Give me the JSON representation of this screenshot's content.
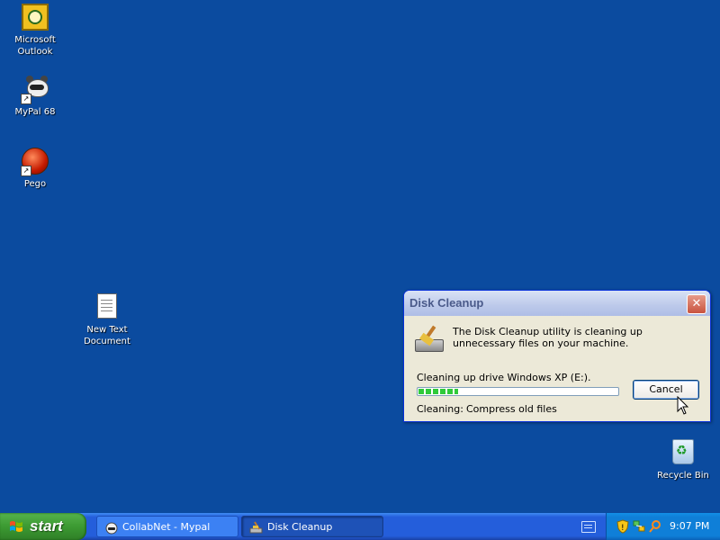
{
  "desktop": {
    "icons": [
      {
        "label_line1": "Microsoft",
        "label_line2": "Outlook",
        "icon": "outlook-icon"
      },
      {
        "label_line1": "MyPal 68",
        "label_line2": "",
        "icon": "mypal-icon"
      },
      {
        "label_line1": "Pego",
        "label_line2": "",
        "icon": "pego-icon"
      },
      {
        "label_line1": "New Text",
        "label_line2": "Document",
        "icon": "text-document-icon"
      },
      {
        "label_line1": "Recycle Bin",
        "label_line2": "",
        "icon": "recycle-bin-icon"
      }
    ]
  },
  "dialog": {
    "title": "Disk Cleanup",
    "description": "The Disk Cleanup utility is cleaning up unnecessary files on your machine.",
    "progress_label": "Cleaning up drive Windows XP (E:).",
    "progress_fraction": 0.2,
    "cancel_label": "Cancel",
    "cleaning_label": "Cleaning:",
    "cleaning_value": "Compress old files",
    "close_glyph": "✕"
  },
  "taskbar": {
    "start_label": "start",
    "tasks": [
      {
        "label": "CollabNet - Mypal",
        "icon": "mypal-icon",
        "active": false
      },
      {
        "label": "Disk Cleanup",
        "icon": "disk-cleanup-icon",
        "active": true
      }
    ],
    "clock": "9:07 PM",
    "tray_icons": [
      "security-shield-icon",
      "network-icon",
      "search-icon"
    ]
  },
  "colors": {
    "desktop": "#0b4b9f",
    "taskbar": "#245edb",
    "start_button": "#3c9a32",
    "progress": "#2fca3a"
  }
}
